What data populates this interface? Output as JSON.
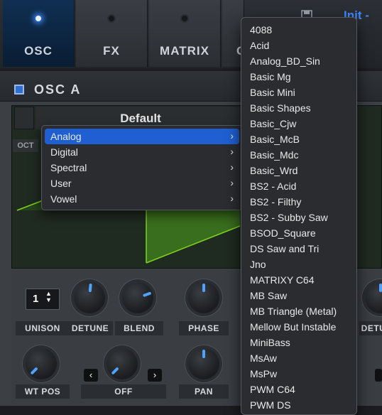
{
  "tabs": [
    {
      "label": "OSC",
      "active": true
    },
    {
      "label": "FX",
      "active": false
    },
    {
      "label": "MATRIX",
      "active": false
    },
    {
      "label": "G",
      "active": false
    }
  ],
  "preset": {
    "name": "Init -"
  },
  "osc": {
    "title": "OSC A",
    "wavetable_name": "Default",
    "oct_label": "OCT"
  },
  "knobs": {
    "unison_value": "1",
    "row1_labels": [
      "UNISON",
      "DETUNE",
      "BLEND",
      "PHASE",
      "DETU"
    ],
    "row2_labels": [
      "WT POS",
      "OFF",
      "PAN"
    ]
  },
  "category_menu": {
    "items": [
      {
        "label": "Analog",
        "selected": true
      },
      {
        "label": "Digital",
        "selected": false
      },
      {
        "label": "Spectral",
        "selected": false
      },
      {
        "label": "User",
        "selected": false
      },
      {
        "label": "Vowel",
        "selected": false
      }
    ]
  },
  "submenu": {
    "items": [
      "4088",
      "Acid",
      "Analog_BD_Sin",
      "Basic Mg",
      "Basic Mini",
      "Basic Shapes",
      "Basic_Cjw",
      "Basic_McB",
      "Basic_Mdc",
      "Basic_Wrd",
      "BS2 - Acid",
      "BS2 - Filthy",
      "BS2 - Subby Saw",
      "BSOD_Square",
      "DS Saw and Tri",
      "Jno",
      "MATRIXY C64",
      "MB Saw",
      "MB Triangle (Metal)",
      "Mellow But Instable",
      "MiniBass",
      "MsAw",
      "MsPw",
      "PWM C64",
      "PWM DS"
    ]
  },
  "colors": {
    "accent": "#3d8bff",
    "menu_selected": "#1f5fd1",
    "wave": "#7ed321"
  }
}
